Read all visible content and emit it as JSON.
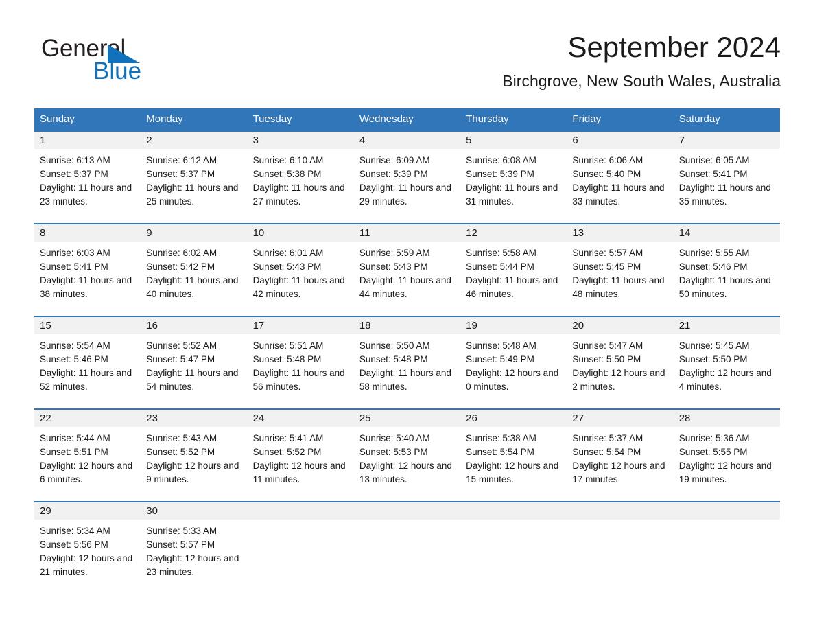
{
  "brand": {
    "name_part1": "General",
    "name_part2": "Blue",
    "triangle_icon": "brand-triangle-icon",
    "color_black": "#231f20",
    "color_blue": "#1271bb"
  },
  "header": {
    "title": "September 2024",
    "subtitle": "Birchgrove, New South Wales, Australia"
  },
  "theme": {
    "header_blue": "#3176b9",
    "day_band_gray": "#f1f1f1",
    "text": "#1a1a1a",
    "page_bg": "#ffffff"
  },
  "weekdays": [
    "Sunday",
    "Monday",
    "Tuesday",
    "Wednesday",
    "Thursday",
    "Friday",
    "Saturday"
  ],
  "weeks": [
    [
      {
        "day": "1",
        "sunrise": "Sunrise: 6:13 AM",
        "sunset": "Sunset: 5:37 PM",
        "daylight": "Daylight: 11 hours and 23 minutes."
      },
      {
        "day": "2",
        "sunrise": "Sunrise: 6:12 AM",
        "sunset": "Sunset: 5:37 PM",
        "daylight": "Daylight: 11 hours and 25 minutes."
      },
      {
        "day": "3",
        "sunrise": "Sunrise: 6:10 AM",
        "sunset": "Sunset: 5:38 PM",
        "daylight": "Daylight: 11 hours and 27 minutes."
      },
      {
        "day": "4",
        "sunrise": "Sunrise: 6:09 AM",
        "sunset": "Sunset: 5:39 PM",
        "daylight": "Daylight: 11 hours and 29 minutes."
      },
      {
        "day": "5",
        "sunrise": "Sunrise: 6:08 AM",
        "sunset": "Sunset: 5:39 PM",
        "daylight": "Daylight: 11 hours and 31 minutes."
      },
      {
        "day": "6",
        "sunrise": "Sunrise: 6:06 AM",
        "sunset": "Sunset: 5:40 PM",
        "daylight": "Daylight: 11 hours and 33 minutes."
      },
      {
        "day": "7",
        "sunrise": "Sunrise: 6:05 AM",
        "sunset": "Sunset: 5:41 PM",
        "daylight": "Daylight: 11 hours and 35 minutes."
      }
    ],
    [
      {
        "day": "8",
        "sunrise": "Sunrise: 6:03 AM",
        "sunset": "Sunset: 5:41 PM",
        "daylight": "Daylight: 11 hours and 38 minutes."
      },
      {
        "day": "9",
        "sunrise": "Sunrise: 6:02 AM",
        "sunset": "Sunset: 5:42 PM",
        "daylight": "Daylight: 11 hours and 40 minutes."
      },
      {
        "day": "10",
        "sunrise": "Sunrise: 6:01 AM",
        "sunset": "Sunset: 5:43 PM",
        "daylight": "Daylight: 11 hours and 42 minutes."
      },
      {
        "day": "11",
        "sunrise": "Sunrise: 5:59 AM",
        "sunset": "Sunset: 5:43 PM",
        "daylight": "Daylight: 11 hours and 44 minutes."
      },
      {
        "day": "12",
        "sunrise": "Sunrise: 5:58 AM",
        "sunset": "Sunset: 5:44 PM",
        "daylight": "Daylight: 11 hours and 46 minutes."
      },
      {
        "day": "13",
        "sunrise": "Sunrise: 5:57 AM",
        "sunset": "Sunset: 5:45 PM",
        "daylight": "Daylight: 11 hours and 48 minutes."
      },
      {
        "day": "14",
        "sunrise": "Sunrise: 5:55 AM",
        "sunset": "Sunset: 5:46 PM",
        "daylight": "Daylight: 11 hours and 50 minutes."
      }
    ],
    [
      {
        "day": "15",
        "sunrise": "Sunrise: 5:54 AM",
        "sunset": "Sunset: 5:46 PM",
        "daylight": "Daylight: 11 hours and 52 minutes."
      },
      {
        "day": "16",
        "sunrise": "Sunrise: 5:52 AM",
        "sunset": "Sunset: 5:47 PM",
        "daylight": "Daylight: 11 hours and 54 minutes."
      },
      {
        "day": "17",
        "sunrise": "Sunrise: 5:51 AM",
        "sunset": "Sunset: 5:48 PM",
        "daylight": "Daylight: 11 hours and 56 minutes."
      },
      {
        "day": "18",
        "sunrise": "Sunrise: 5:50 AM",
        "sunset": "Sunset: 5:48 PM",
        "daylight": "Daylight: 11 hours and 58 minutes."
      },
      {
        "day": "19",
        "sunrise": "Sunrise: 5:48 AM",
        "sunset": "Sunset: 5:49 PM",
        "daylight": "Daylight: 12 hours and 0 minutes."
      },
      {
        "day": "20",
        "sunrise": "Sunrise: 5:47 AM",
        "sunset": "Sunset: 5:50 PM",
        "daylight": "Daylight: 12 hours and 2 minutes."
      },
      {
        "day": "21",
        "sunrise": "Sunrise: 5:45 AM",
        "sunset": "Sunset: 5:50 PM",
        "daylight": "Daylight: 12 hours and 4 minutes."
      }
    ],
    [
      {
        "day": "22",
        "sunrise": "Sunrise: 5:44 AM",
        "sunset": "Sunset: 5:51 PM",
        "daylight": "Daylight: 12 hours and 6 minutes."
      },
      {
        "day": "23",
        "sunrise": "Sunrise: 5:43 AM",
        "sunset": "Sunset: 5:52 PM",
        "daylight": "Daylight: 12 hours and 9 minutes."
      },
      {
        "day": "24",
        "sunrise": "Sunrise: 5:41 AM",
        "sunset": "Sunset: 5:52 PM",
        "daylight": "Daylight: 12 hours and 11 minutes."
      },
      {
        "day": "25",
        "sunrise": "Sunrise: 5:40 AM",
        "sunset": "Sunset: 5:53 PM",
        "daylight": "Daylight: 12 hours and 13 minutes."
      },
      {
        "day": "26",
        "sunrise": "Sunrise: 5:38 AM",
        "sunset": "Sunset: 5:54 PM",
        "daylight": "Daylight: 12 hours and 15 minutes."
      },
      {
        "day": "27",
        "sunrise": "Sunrise: 5:37 AM",
        "sunset": "Sunset: 5:54 PM",
        "daylight": "Daylight: 12 hours and 17 minutes."
      },
      {
        "day": "28",
        "sunrise": "Sunrise: 5:36 AM",
        "sunset": "Sunset: 5:55 PM",
        "daylight": "Daylight: 12 hours and 19 minutes."
      }
    ],
    [
      {
        "day": "29",
        "sunrise": "Sunrise: 5:34 AM",
        "sunset": "Sunset: 5:56 PM",
        "daylight": "Daylight: 12 hours and 21 minutes."
      },
      {
        "day": "30",
        "sunrise": "Sunrise: 5:33 AM",
        "sunset": "Sunset: 5:57 PM",
        "daylight": "Daylight: 12 hours and 23 minutes."
      },
      {
        "day": "",
        "sunrise": "",
        "sunset": "",
        "daylight": ""
      },
      {
        "day": "",
        "sunrise": "",
        "sunset": "",
        "daylight": ""
      },
      {
        "day": "",
        "sunrise": "",
        "sunset": "",
        "daylight": ""
      },
      {
        "day": "",
        "sunrise": "",
        "sunset": "",
        "daylight": ""
      },
      {
        "day": "",
        "sunrise": "",
        "sunset": "",
        "daylight": ""
      }
    ]
  ]
}
